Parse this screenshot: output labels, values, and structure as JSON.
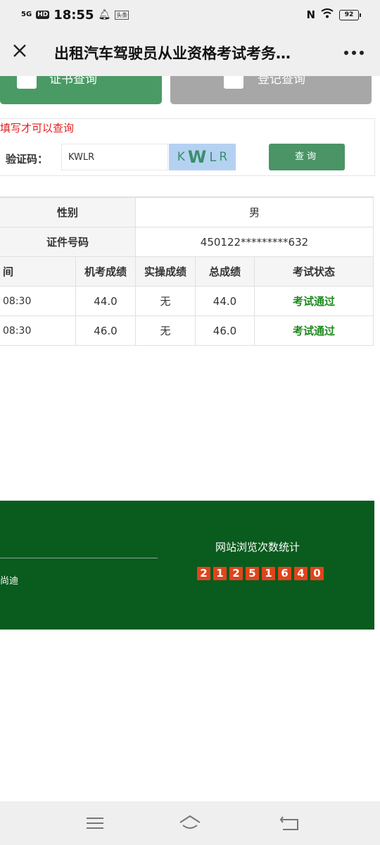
{
  "status_bar": {
    "signal": "5G",
    "hd": "HD",
    "time": "18:55",
    "app_badge": "头条",
    "battery": "92"
  },
  "header": {
    "title": "出租汽车驾驶员从业资格考试考务…",
    "close_icon": "close-icon",
    "more_icon": "more-dots-icon"
  },
  "top_buttons": {
    "cert_query_label": "证书查询",
    "register_query_label": "登记查询"
  },
  "form": {
    "notice": "填写才可以查询",
    "verify_label": "验证码：",
    "verify_value": "KWLR",
    "captcha_chars": [
      "K",
      "W",
      "L",
      "R"
    ],
    "query_button": "查询"
  },
  "info_rows": [
    {
      "label": "性别",
      "value": "男"
    },
    {
      "label": "证件号码",
      "value": "450122*********632"
    }
  ],
  "score_table": {
    "headers": [
      "间",
      "机考成绩",
      "实操成绩",
      "总成绩",
      "考试状态"
    ],
    "rows": [
      {
        "time": "08:30",
        "computer": "44.0",
        "practical": "无",
        "total": "44.0",
        "status": "考试通过"
      },
      {
        "time": "08:30",
        "computer": "46.0",
        "practical": "无",
        "total": "46.0",
        "status": "考试通过"
      }
    ]
  },
  "footer": {
    "left_text": "尚迪",
    "visit_label": "网站浏览次数统计",
    "counter_digits": [
      "2",
      "1",
      "2",
      "5",
      "1",
      "6",
      "4",
      "0"
    ]
  },
  "colors": {
    "accent_green": "#4a9466",
    "footer_green": "#095b1e",
    "pass_green": "#1b8a1b",
    "notice_red": "#e02020",
    "counter_red": "#e0441c"
  }
}
